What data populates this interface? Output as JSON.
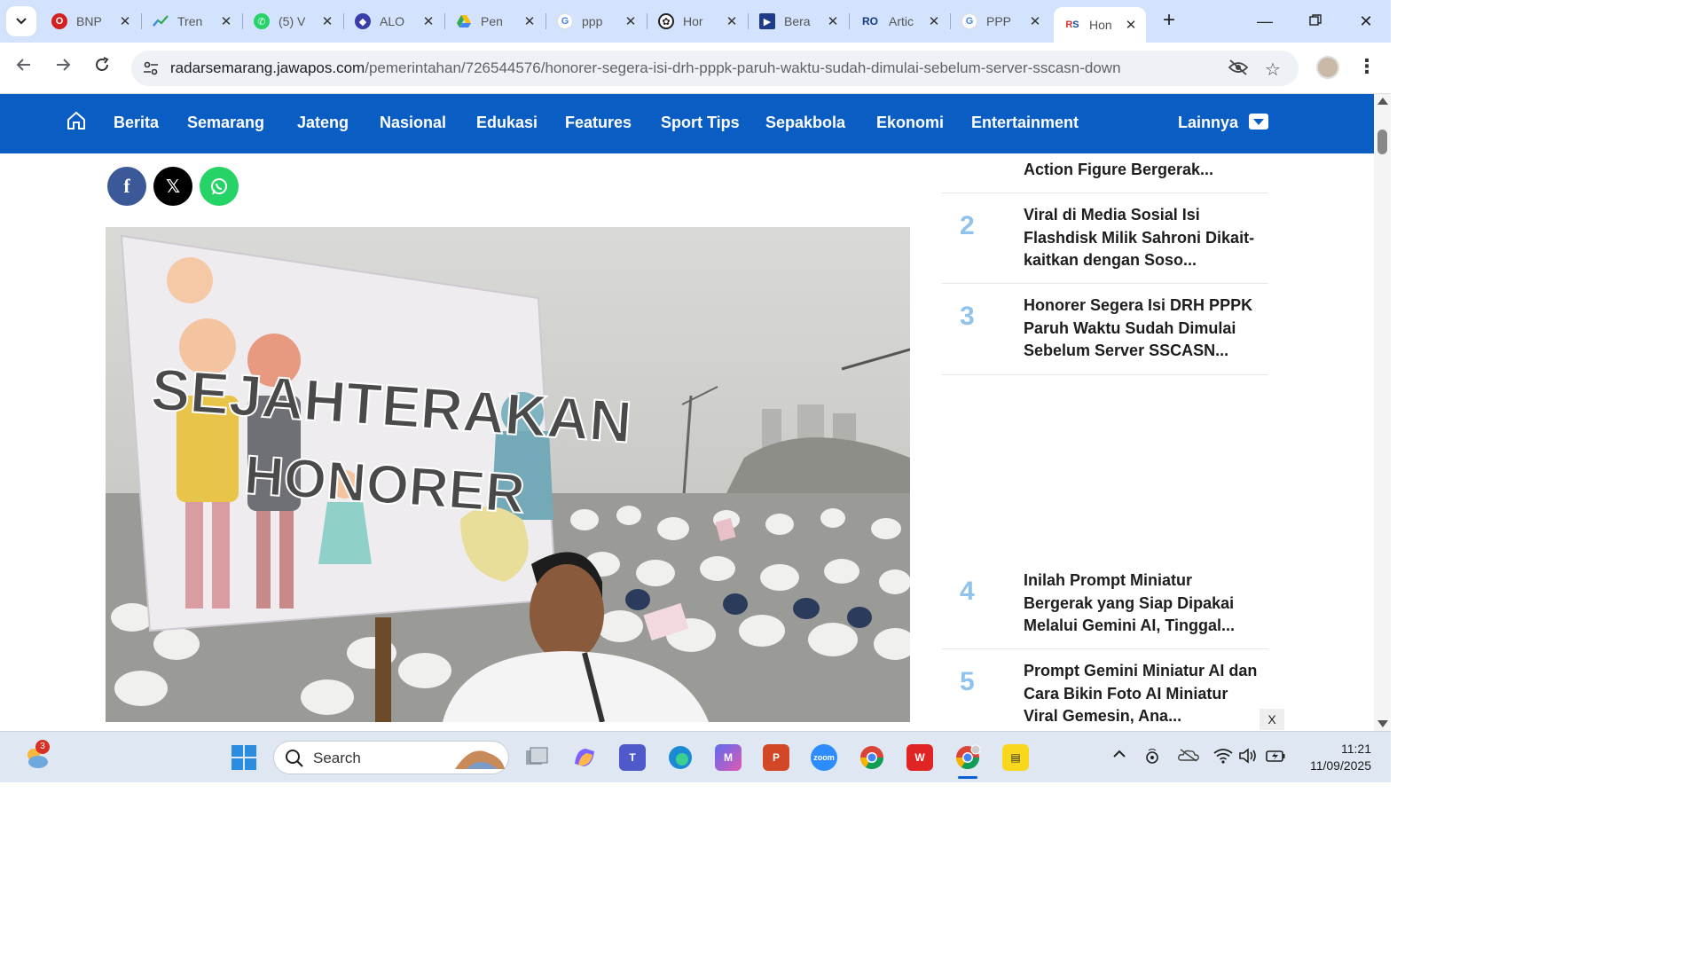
{
  "browser": {
    "tabs": [
      {
        "title": "BNP",
        "favicon_color": "#d32020",
        "favicon": "opera-icon"
      },
      {
        "title": "Tren",
        "favicon_color": "#2f6fde",
        "favicon": "trends-icon"
      },
      {
        "title": "(5) V",
        "favicon_color": "#25d366",
        "favicon": "whatsapp-icon"
      },
      {
        "title": "ALO",
        "favicon_color": "#3b3ea8",
        "favicon": "shield-icon"
      },
      {
        "title": "Pen",
        "favicon_color": "#f4b400",
        "favicon": "drive-icon"
      },
      {
        "title": "ppp",
        "favicon_color": "#4285f4",
        "favicon": "google-icon"
      },
      {
        "title": "Hor",
        "favicon_color": "#222222",
        "favicon": "openai-icon"
      },
      {
        "title": "Bera",
        "favicon_color": "#1f3c88",
        "favicon": "flag-icon"
      },
      {
        "title": "Artic",
        "favicon_color": "#163a8a",
        "favicon": "ro-icon"
      },
      {
        "title": "PPP",
        "favicon_color": "#4285f4",
        "favicon": "google-icon"
      },
      {
        "title": "Hon",
        "favicon_color": "#d33",
        "favicon": "rs-icon",
        "active": true
      }
    ],
    "url_domain": "radarsemarang.jawapos.com",
    "url_path": "/pemerintahan/726544576/honorer-segera-isi-drh-pppk-paruh-waktu-sudah-dimulai-sebelum-server-sscasn-down"
  },
  "site_nav": {
    "items": [
      "Berita",
      "Semarang",
      "Jateng",
      "Nasional",
      "Edukasi",
      "Features",
      "Sport Tips",
      "Sepakbola",
      "Ekonomi",
      "Entertainment"
    ],
    "more_label": "Lainnya"
  },
  "hero": {
    "sign_line1": "SEJAHTERAKAN",
    "sign_line2": "HONORER"
  },
  "trending": [
    {
      "num": "",
      "title": "Action Figure Bergerak..."
    },
    {
      "num": "2",
      "title": "Viral di Media Sosial Isi Flashdisk Milik Sahroni Dikait-kaitkan dengan Soso..."
    },
    {
      "num": "3",
      "title": "Honorer Segera Isi DRH PPPK Paruh Waktu Sudah Dimulai Sebelum Server SSCASN..."
    },
    {
      "num": "4",
      "title": "Inilah Prompt Miniatur Bergerak yang Siap Dipakai Melalui Gemini AI, Tinggal..."
    },
    {
      "num": "5",
      "title": "Prompt Gemini Miniatur AI dan Cara Bikin Foto AI Miniatur Viral Gemesin, Ana..."
    }
  ],
  "ad_close": "X",
  "taskbar": {
    "search_label": "Search",
    "weather_badge": "3",
    "time": "11:21",
    "date": "11/09/2025"
  }
}
